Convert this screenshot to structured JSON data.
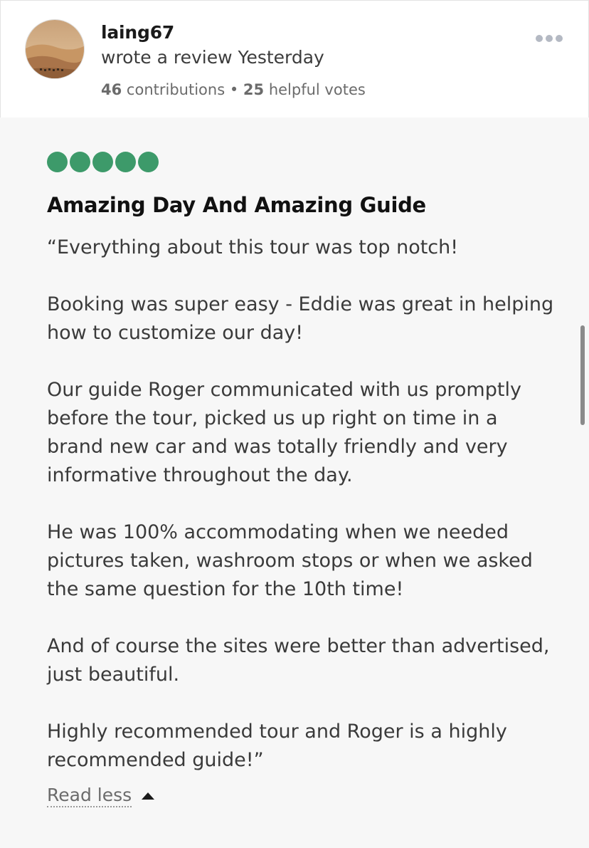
{
  "review": {
    "username": "laing67",
    "action_text": "wrote a review Yesterday",
    "contributions_count": "46",
    "contributions_label": "contributions",
    "separator": "•",
    "helpful_votes_count": "25",
    "helpful_votes_label": "helpful votes",
    "rating": 5,
    "rating_max": 5,
    "title": "Amazing Day And Amazing Guide",
    "paragraphs": [
      "“Everything about this tour was top notch!",
      "Booking was super easy - Eddie was great in helping how to customize our day!",
      "Our guide Roger communicated with us promptly before the tour, picked us up right on time in a brand new car and was totally friendly and very informative throughout the day.",
      "He was 100% accommodating when we needed pictures taken, washroom stops or when we asked the same question for the 10th time!",
      "And of course the sites were better than advertised, just beautiful.",
      "Highly recommended tour and Roger is a highly recommended guide!”"
    ],
    "read_less_label": "Read less"
  },
  "colors": {
    "rating_bubble": "#3d9a6a",
    "background": "#f7f7f7",
    "header_background": "#ffffff"
  },
  "icons": {
    "more_options": "more-horizontal-icon",
    "read_less_caret": "caret-up-icon"
  }
}
